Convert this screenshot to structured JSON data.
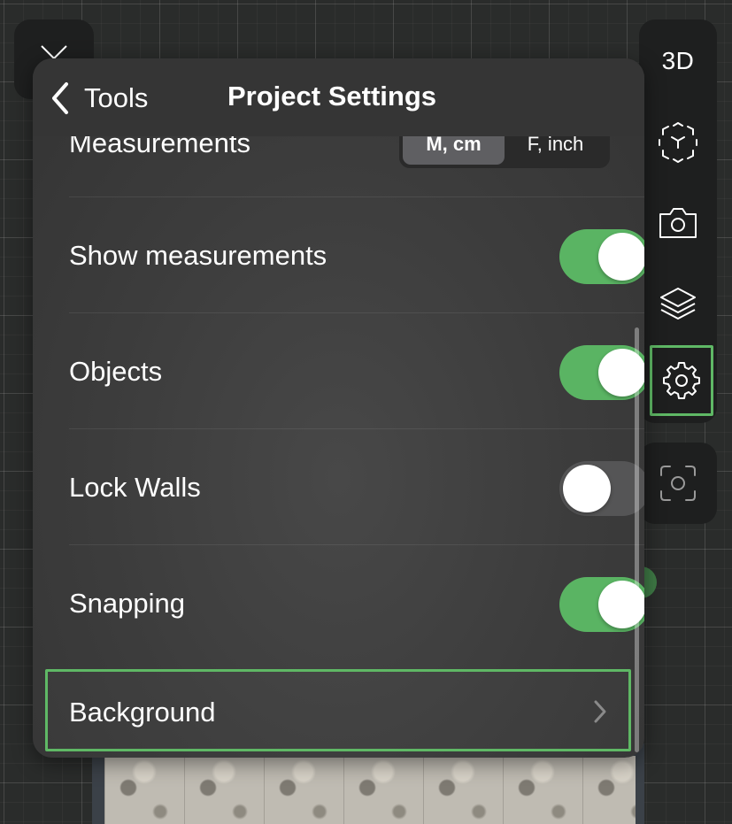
{
  "header": {
    "back_label": "Tools",
    "title": "Project Settings"
  },
  "settings": {
    "measurements": {
      "label": "Measurements",
      "options": [
        "M, cm",
        "F, inch"
      ],
      "selected": "M, cm"
    },
    "show_measurements": {
      "label": "Show measurements",
      "enabled": true
    },
    "objects": {
      "label": "Objects",
      "enabled": true
    },
    "lock_walls": {
      "label": "Lock Walls",
      "enabled": false
    },
    "snapping": {
      "label": "Snapping",
      "enabled": true
    },
    "background": {
      "label": "Background"
    }
  },
  "toolbar": {
    "view_3d_label": "3D",
    "items": [
      "3d-view",
      "ar-cube-icon",
      "camera-icon",
      "layers-icon",
      "gear-icon"
    ],
    "active": "gear-icon",
    "bottom_item": "screenshot-icon"
  },
  "colors": {
    "accent_green": "#5ab463",
    "highlight_border": "#5fb865",
    "panel_bg": "#3c3c3c",
    "toolbar_bg": "#1e1f1f"
  }
}
